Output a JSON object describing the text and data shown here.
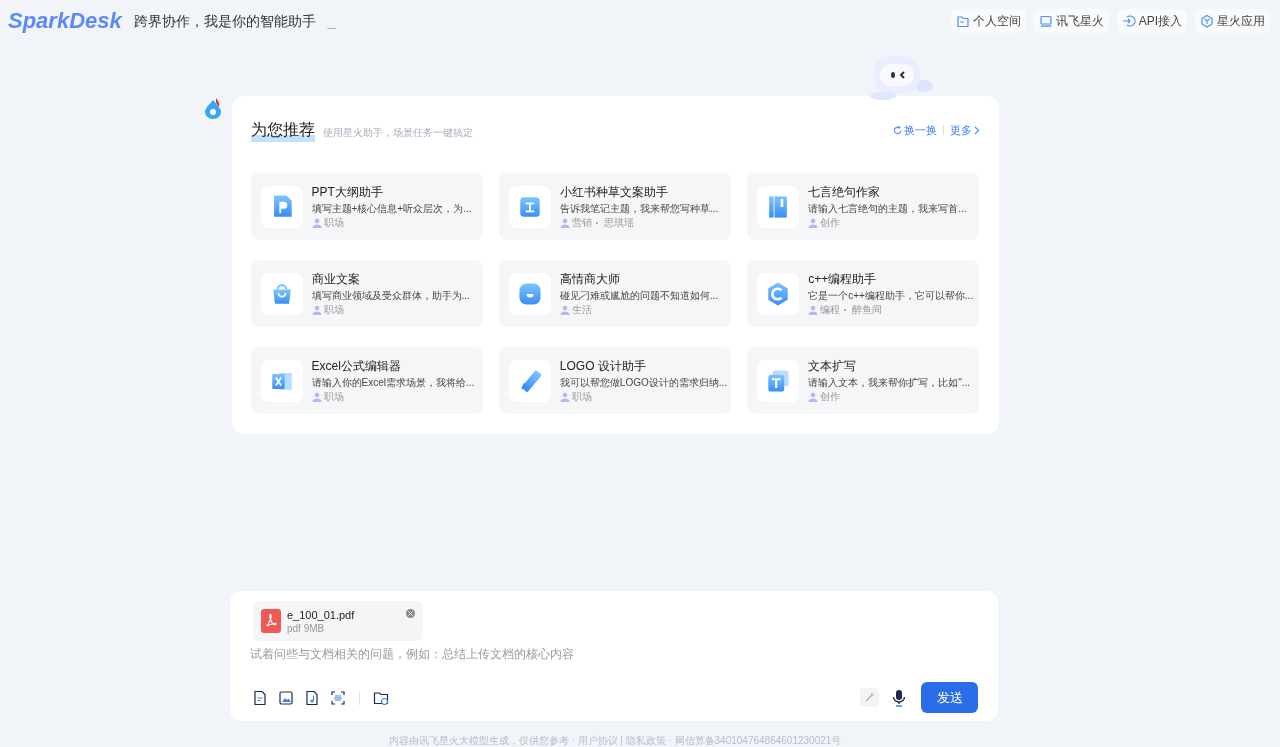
{
  "header": {
    "logo": "SparkDesk",
    "tagline": "跨界协作，我是你的智能助手",
    "cursor": "_",
    "links": [
      {
        "label": "个人空间"
      },
      {
        "label": "讯飞星火"
      },
      {
        "label": "API接入"
      },
      {
        "label": "星火应用"
      }
    ]
  },
  "recommend": {
    "title": "为您推荐",
    "subtitle": "使用星火助手，场景任务一键搞定",
    "refresh": "换一换",
    "more": "更多",
    "cards": [
      {
        "title": "PPT大纲助手",
        "desc": "填写主题+核心信息+听众层次，为...",
        "tags": [
          "职场"
        ]
      },
      {
        "title": "小红书种草文案助手",
        "desc": "告诉我笔记主题，我来帮您写种草...",
        "tags": [
          "营销",
          "思琪瑶"
        ]
      },
      {
        "title": "七言绝句作家",
        "desc": "请输入七言绝句的主题，我来写首...",
        "tags": [
          "创作"
        ]
      },
      {
        "title": "商业文案",
        "desc": "填写商业领域及受众群体，助手为...",
        "tags": [
          "职场"
        ]
      },
      {
        "title": "高情商大师",
        "desc": "碰见刁难或尴尬的问题不知道如何...",
        "tags": [
          "生活"
        ]
      },
      {
        "title": "c++编程助手",
        "desc": "它是一个c++编程助手，它可以帮你...",
        "tags": [
          "编程",
          "醉鱼间"
        ]
      },
      {
        "title": "Excel公式编辑器",
        "desc": "请输入你的Excel需求场景，我将给...",
        "tags": [
          "职场"
        ]
      },
      {
        "title": "LOGO 设计助手",
        "desc": "我可以帮您做LOGO设计的需求归纳...",
        "tags": [
          "职场"
        ]
      },
      {
        "title": "文本扩写",
        "desc": "请输入文本，我来帮你扩写，比如\"...",
        "tags": [
          "创作"
        ]
      }
    ]
  },
  "composer": {
    "file": {
      "name": "e_100_01.pdf",
      "meta": "pdf 9MB"
    },
    "placeholder": "试着问些与文档相关的问题，例如：总结上传文档的核心内容",
    "send": "发送"
  },
  "footer": "内容由讯飞星火大模型生成，仅供您参考 · 用户协议 | 隐私政策 · 网信算备340104764864601230021号"
}
